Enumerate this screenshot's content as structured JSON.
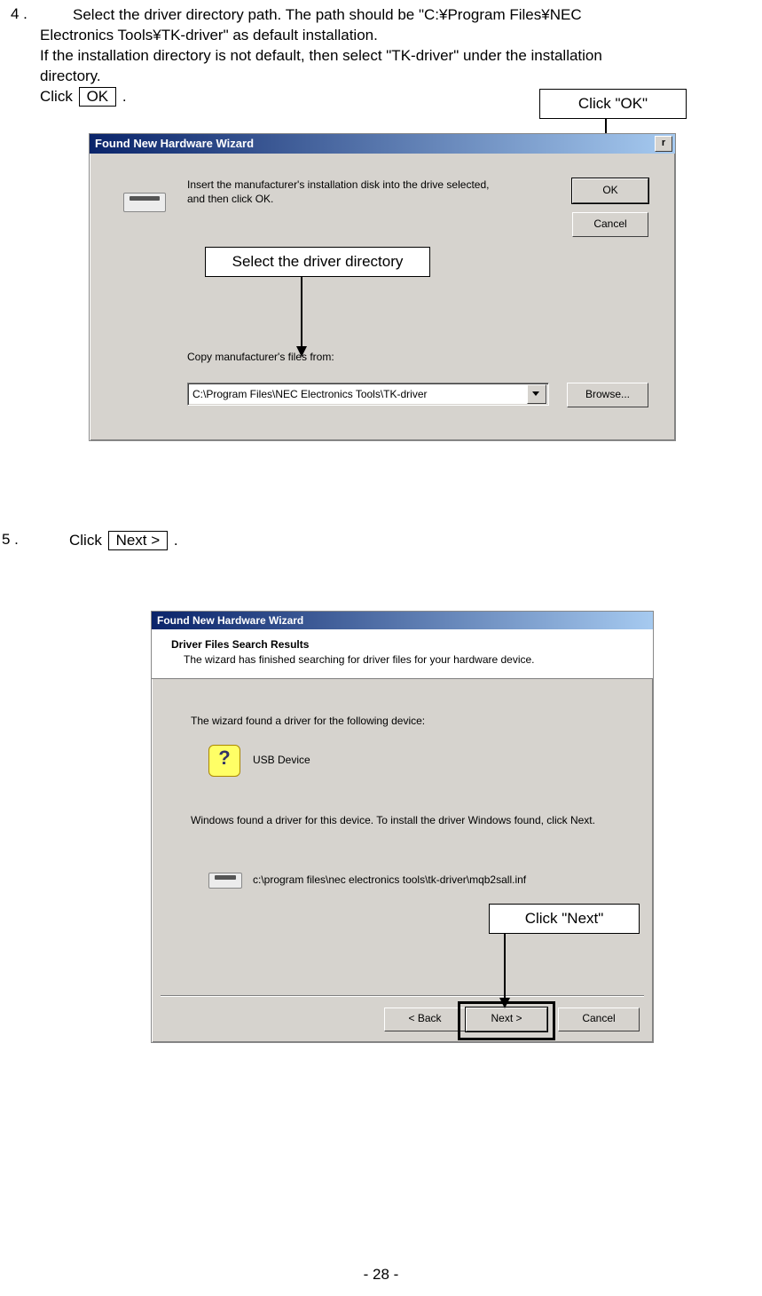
{
  "step4": {
    "num": "4 .",
    "line1": "Select the driver directory path. The path should be \"C:¥Program Files¥NEC",
    "line2": "Electronics Tools¥TK-driver\" as default installation.",
    "line3": "If the installation directory is not default, then select \"TK-driver\" under the installation",
    "line4": "directory.",
    "click_prefix": "Click ",
    "ok_btn_inline": " OK ",
    "click_suffix": " ."
  },
  "callouts": {
    "click_ok": "Click \"OK\"",
    "select_dir": "Select the driver directory",
    "click_next": "Click \"Next\""
  },
  "dialog1": {
    "title": "Found New Hardware Wizard",
    "x": "r",
    "body": "Insert the manufacturer's installation disk into the drive selected, and then click OK.",
    "copy_label": "Copy manufacturer's files from:",
    "combo_value": "C:\\Program Files\\NEC Electronics Tools\\TK-driver",
    "ok": "OK",
    "cancel": "Cancel",
    "browse": "Browse..."
  },
  "step5": {
    "num": "5 .",
    "click_prefix": "Click ",
    "next_btn_inline": " Next > ",
    "click_suffix": " ."
  },
  "dialog2": {
    "title": "Found New Hardware Wizard",
    "header_title": "Driver Files Search Results",
    "header_sub": "The wizard has finished searching for driver files for your hardware device.",
    "line1": "The wizard found a driver for the following device:",
    "device_q": "?",
    "device_name": "USB Device",
    "line2": "Windows found a driver for this device. To install the driver Windows found, click Next.",
    "path": "c:\\program files\\nec electronics tools\\tk-driver\\mqb2sall.inf",
    "back": "< Back",
    "next": "Next >",
    "cancel": "Cancel"
  },
  "page_number": "- 28 -"
}
